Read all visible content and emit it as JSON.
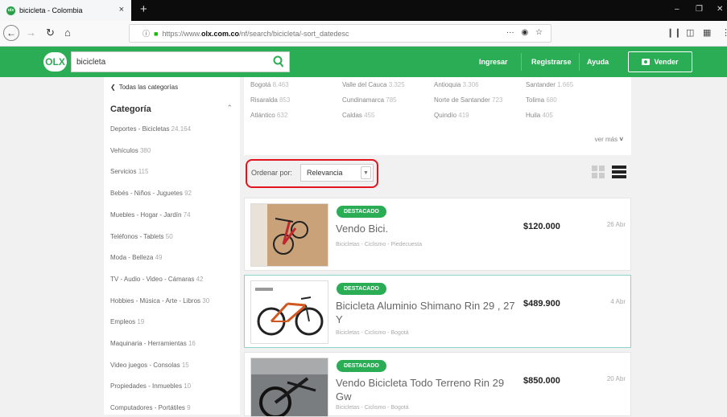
{
  "browser": {
    "tab_title": "bicicleta - Colombia",
    "tab_favicon_text": "olx",
    "tab_close": "×",
    "new_tab": "+",
    "url_prefix": "https://www.",
    "url_domain": "olx.com.co",
    "url_suffix": "/nf/search/bicicleta/-sort_datedesc",
    "url_menu": "···"
  },
  "header": {
    "logo": "OLX",
    "search_value": "bicicleta",
    "links": [
      "Ingresar",
      "Registrarse",
      "Ayuda"
    ],
    "sell_label": "Vender"
  },
  "sidebar": {
    "all_categories": "Todas las categorías",
    "category_title": "Categoría",
    "categories": [
      {
        "name": "Deportes - Bicicletas",
        "count": "24.164"
      },
      {
        "name": "Vehículos",
        "count": "380"
      },
      {
        "name": "Servicios",
        "count": "115"
      },
      {
        "name": "Bebés - Niños - Juguetes",
        "count": "92"
      },
      {
        "name": "Muebles - Hogar - Jardín",
        "count": "74"
      },
      {
        "name": "Teléfonos - Tablets",
        "count": "50"
      },
      {
        "name": "Moda - Belleza",
        "count": "49"
      },
      {
        "name": "TV - Audio - Video - Cámaras",
        "count": "42"
      },
      {
        "name": "Hobbies - Música - Arte - Libros",
        "count": "30"
      },
      {
        "name": "Empleos",
        "count": "19"
      },
      {
        "name": "Maquinaria - Herramientas",
        "count": "16"
      },
      {
        "name": "Video juegos - Consolas",
        "count": "15"
      },
      {
        "name": "Propiedades - Inmuebles",
        "count": "10"
      },
      {
        "name": "Computadores - Portátiles",
        "count": "9"
      }
    ]
  },
  "regions": {
    "items": [
      {
        "name": "Bogotá",
        "count": "8.463"
      },
      {
        "name": "Valle del Cauca",
        "count": "3.325"
      },
      {
        "name": "Antioquia",
        "count": "3.306"
      },
      {
        "name": "Santander",
        "count": "1.665"
      },
      {
        "name": "Risaralda",
        "count": "853"
      },
      {
        "name": "Cundinamarca",
        "count": "785"
      },
      {
        "name": "Norte de Santander",
        "count": "723"
      },
      {
        "name": "Tolima",
        "count": "680"
      },
      {
        "name": "Atlántico",
        "count": "632"
      },
      {
        "name": "Caldas",
        "count": "455"
      },
      {
        "name": "Quindío",
        "count": "419"
      },
      {
        "name": "Huila",
        "count": "405"
      }
    ],
    "more_label": "ver más"
  },
  "sort": {
    "label": "Ordenar por:",
    "selected": "Relevancia"
  },
  "listings": [
    {
      "badge": "DESTACADO",
      "title": "Vendo Bici.",
      "category": "Bicicletas - Ciclismo - Piedecuesta",
      "price": "$120.000",
      "date": "26 Abr"
    },
    {
      "badge": "DESTACADO",
      "title": "Bicicleta Aluminio Shimano Rin 29 , 27 Y",
      "category": "Bicicletas - Ciclismo - Bogotá",
      "price": "$489.900",
      "date": "4 Abr"
    },
    {
      "badge": "DESTACADO",
      "title": "Vendo Bicicleta Todo Terreno Rin 29 Gw",
      "category": "Bicicletas - Ciclismo - Bogotá",
      "price": "$850.000",
      "date": "20 Abr"
    }
  ]
}
